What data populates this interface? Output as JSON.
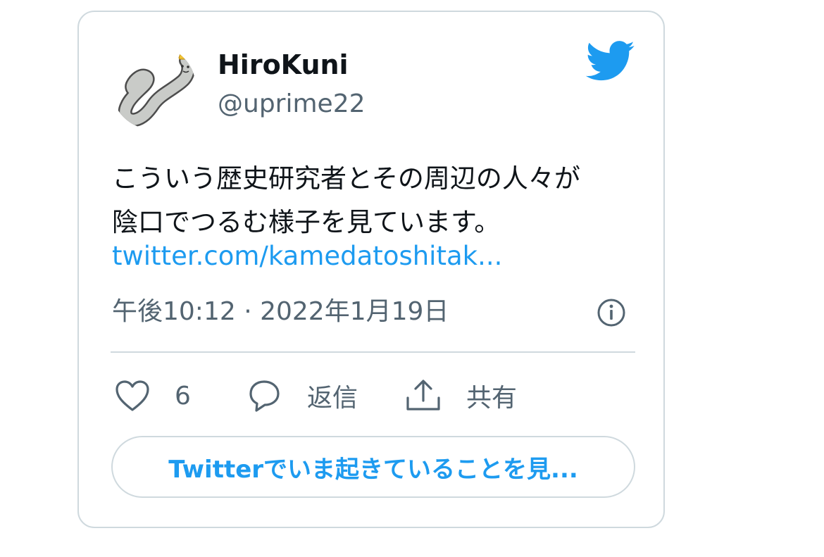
{
  "author": {
    "display_name": "HiroKuni",
    "handle": "@uprime22",
    "avatar_icon": "eel-character-avatar-icon"
  },
  "brand": {
    "logo_icon": "twitter-bird-icon",
    "accent_color": "#1d9bf0"
  },
  "tweet": {
    "text_lines": [
      "こういう歴史研究者とその周辺の人々が",
      "陰口でつるむ様子を見ています。"
    ],
    "link_text": "twitter.com/kamedatoshitak...",
    "timestamp": "午後10:12 · 2022年1月19日"
  },
  "actions": {
    "like_icon": "heart-icon",
    "like_count": "6",
    "reply_icon": "speech-bubble-icon",
    "reply_label": "返信",
    "share_icon": "share-upload-icon",
    "share_label": "共有",
    "info_icon": "info-icon"
  },
  "cta": {
    "label": "Twitterでいま起きていることを見..."
  }
}
